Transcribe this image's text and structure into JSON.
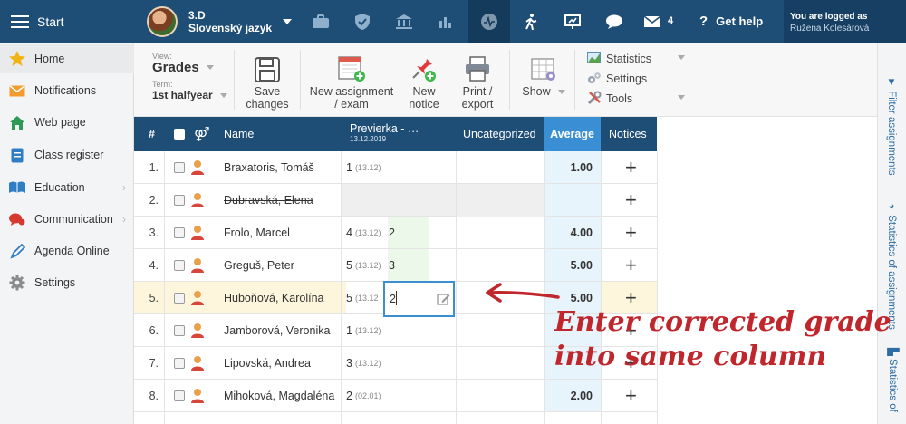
{
  "topbar": {
    "start_label": "Start",
    "class_name": "3.D",
    "subject": "Slovenský jazyk",
    "message_count": "4",
    "help_label": "Get help",
    "logged_in_label": "You are logged as",
    "user_name": "Ružena Kolesárová",
    "nav_icons": [
      "briefcase-icon",
      "shield-icon",
      "bank-icon",
      "bar-chart-icon",
      "activity-icon",
      "walking-icon",
      "presentation-icon",
      "chat-icon",
      "mail-icon"
    ]
  },
  "sidebar": {
    "items": [
      {
        "label": "Home",
        "icon": "star-icon"
      },
      {
        "label": "Notifications",
        "icon": "envelope-icon"
      },
      {
        "label": "Web page",
        "icon": "home-icon"
      },
      {
        "label": "Class register",
        "icon": "register-icon"
      },
      {
        "label": "Education",
        "icon": "book-icon"
      },
      {
        "label": "Communication",
        "icon": "chat-icon"
      },
      {
        "label": "Agenda Online",
        "icon": "pen-icon"
      },
      {
        "label": "Settings",
        "icon": "gear-icon"
      }
    ]
  },
  "toolbar": {
    "view_label": "View:",
    "view_value": "Grades",
    "term_label": "Term:",
    "term_value": "1st halfyear",
    "save_line1": "Save",
    "save_line2": "changes",
    "new_assignment_line1": "New assignment",
    "new_assignment_line2": "/ exam",
    "new_notice_line1": "New",
    "new_notice_line2": "notice",
    "print_line1": "Print /",
    "print_line2": "export",
    "show_label": "Show",
    "statistics_label": "Statistics",
    "settings_label": "Settings",
    "tools_label": "Tools"
  },
  "right_strip": {
    "filter": "Filter assignments",
    "stats": "Statistics of assignments",
    "stats2": "Statistics of"
  },
  "table": {
    "col_num": "#",
    "col_name": "Name",
    "col_assignment": "Previerka - …",
    "col_assignment_date": "13.12.2019",
    "col_uncategorized": "Uncategorized",
    "col_average": "Average",
    "col_notices": "Notices",
    "rows": [
      {
        "n": "1.",
        "name": "Braxatoris, Tomáš",
        "grade": "1",
        "date": "(13.12)",
        "corr": "",
        "avg": "1.00"
      },
      {
        "n": "2.",
        "name": "Dubravská, Elena",
        "grade": "",
        "date": "",
        "corr": "",
        "avg": ""
      },
      {
        "n": "3.",
        "name": "Frolo, Marcel",
        "grade": "4",
        "date": "(13.12)",
        "corr": "2",
        "avg": "4.00"
      },
      {
        "n": "4.",
        "name": "Greguš, Peter",
        "grade": "5",
        "date": "(13.12)",
        "corr": "3",
        "avg": "5.00"
      },
      {
        "n": "5.",
        "name": "Huboňová, Karolína",
        "grade": "5",
        "date": "(13.12",
        "corr": "",
        "avg": "5.00"
      },
      {
        "n": "6.",
        "name": "Jamborová, Veronika",
        "grade": "1",
        "date": "(13.12)",
        "corr": "",
        "avg": ""
      },
      {
        "n": "7.",
        "name": "Lipovská, Andrea",
        "grade": "3",
        "date": "(13.12)",
        "corr": "",
        "avg": ""
      },
      {
        "n": "8.",
        "name": "Mihoková, Magdaléna",
        "grade": "2",
        "date": "(02.01)",
        "corr": "",
        "avg": "2.00"
      }
    ],
    "editing_value": "2",
    "notice_symbol": "+"
  },
  "annotation": {
    "line1": "Enter corrected grade",
    "line2": "into same column"
  },
  "colors": {
    "topbar": "#1e4d76",
    "average_header": "#3a8fd4",
    "annotation": "#c0272d",
    "highlight_row": "#fdf6dc"
  }
}
